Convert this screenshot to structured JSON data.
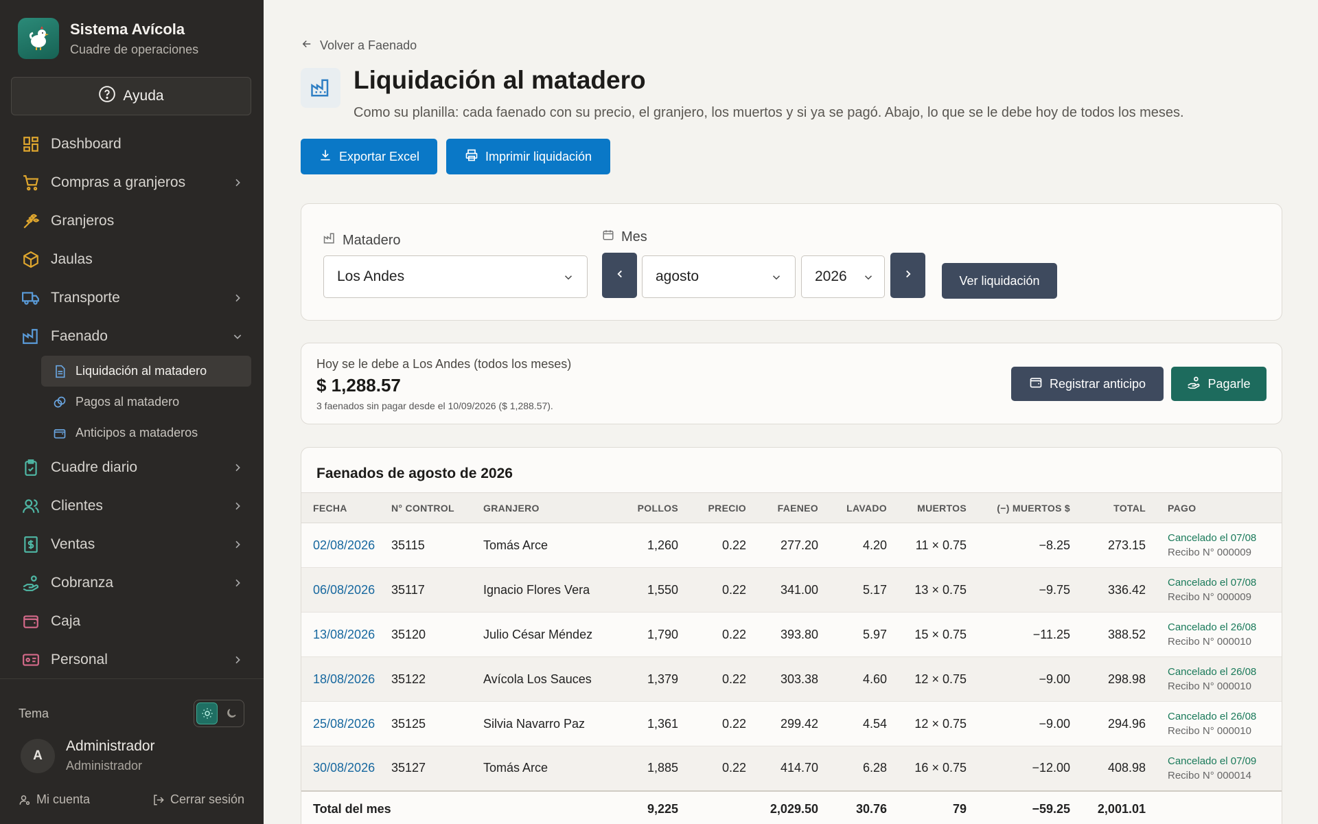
{
  "sidebar": {
    "brand_title": "Sistema Avícola",
    "brand_subtitle": "Cuadre de operaciones",
    "help_label": "Ayuda",
    "items": [
      {
        "label": "Dashboard"
      },
      {
        "label": "Compras a granjeros"
      },
      {
        "label": "Granjeros"
      },
      {
        "label": "Jaulas"
      },
      {
        "label": "Transporte"
      },
      {
        "label": "Faenado"
      },
      {
        "label": "Cuadre diario"
      },
      {
        "label": "Clientes"
      },
      {
        "label": "Ventas"
      },
      {
        "label": "Cobranza"
      },
      {
        "label": "Caja"
      },
      {
        "label": "Personal"
      }
    ],
    "sub_items": [
      {
        "label": "Liquidación al matadero"
      },
      {
        "label": "Pagos al matadero"
      },
      {
        "label": "Anticipos a mataderos"
      }
    ],
    "theme_label": "Tema",
    "user_initial": "A",
    "user_name": "Administrador",
    "user_role": "Administrador",
    "account_label": "Mi cuenta",
    "logout_label": "Cerrar sesión",
    "accent_color": "#1d6b5d"
  },
  "header": {
    "back_label": "Volver a Faenado",
    "title": "Liquidación al matadero",
    "description": "Como su planilla: cada faenado con su precio, el granjero, los muertos y si ya se pagó. Abajo, lo que se le debe hoy de todos los meses.",
    "export_label": "Exportar Excel",
    "print_label": "Imprimir liquidación",
    "primary_color": "#0a78c7"
  },
  "filters": {
    "matadero_label": "Matadero",
    "matadero_value": "Los Andes",
    "mes_label": "Mes",
    "month_value": "agosto",
    "year_value": "2026",
    "ver_label": "Ver liquidación"
  },
  "debt": {
    "label": "Hoy se le debe a Los Andes (todos los meses)",
    "amount": "$ 1,288.57",
    "note": "3 faenados sin pagar desde el 10/09/2026 ($ 1,288.57).",
    "anticipo_label": "Registrar anticipo",
    "pagar_label": "Pagarle"
  },
  "table": {
    "title": "Faenados de agosto de 2026",
    "headers": [
      "FECHA",
      "N° CONTROL",
      "GRANJERO",
      "POLLOS",
      "PRECIO",
      "FAENEO",
      "LAVADO",
      "MUERTOS",
      "(−) MUERTOS $",
      "TOTAL",
      "PAGO"
    ],
    "rows": [
      {
        "fecha": "02/08/2026",
        "control": "35115",
        "granjero": "Tomás Arce",
        "pollos": "1,260",
        "precio": "0.22",
        "faeneo": "277.20",
        "lavado": "4.20",
        "muertos": "11 × 0.75",
        "muertos_monto": "−8.25",
        "total": "273.15",
        "pago": "Cancelado el 07/08",
        "recibo": "Recibo N° 000009"
      },
      {
        "fecha": "06/08/2026",
        "control": "35117",
        "granjero": "Ignacio Flores Vera",
        "pollos": "1,550",
        "precio": "0.22",
        "faeneo": "341.00",
        "lavado": "5.17",
        "muertos": "13 × 0.75",
        "muertos_monto": "−9.75",
        "total": "336.42",
        "pago": "Cancelado el 07/08",
        "recibo": "Recibo N° 000009"
      },
      {
        "fecha": "13/08/2026",
        "control": "35120",
        "granjero": "Julio César Méndez",
        "pollos": "1,790",
        "precio": "0.22",
        "faeneo": "393.80",
        "lavado": "5.97",
        "muertos": "15 × 0.75",
        "muertos_monto": "−11.25",
        "total": "388.52",
        "pago": "Cancelado el 26/08",
        "recibo": "Recibo N° 000010"
      },
      {
        "fecha": "18/08/2026",
        "control": "35122",
        "granjero": "Avícola Los Sauces",
        "pollos": "1,379",
        "precio": "0.22",
        "faeneo": "303.38",
        "lavado": "4.60",
        "muertos": "12 × 0.75",
        "muertos_monto": "−9.00",
        "total": "298.98",
        "pago": "Cancelado el 26/08",
        "recibo": "Recibo N° 000010"
      },
      {
        "fecha": "25/08/2026",
        "control": "35125",
        "granjero": "Silvia Navarro Paz",
        "pollos": "1,361",
        "precio": "0.22",
        "faeneo": "299.42",
        "lavado": "4.54",
        "muertos": "12 × 0.75",
        "muertos_monto": "−9.00",
        "total": "294.96",
        "pago": "Cancelado el 26/08",
        "recibo": "Recibo N° 000010"
      },
      {
        "fecha": "30/08/2026",
        "control": "35127",
        "granjero": "Tomás Arce",
        "pollos": "1,885",
        "precio": "0.22",
        "faeneo": "414.70",
        "lavado": "6.28",
        "muertos": "16 × 0.75",
        "muertos_monto": "−12.00",
        "total": "408.98",
        "pago": "Cancelado el 07/09",
        "recibo": "Recibo N° 000014"
      }
    ],
    "total_row": {
      "label": "Total del mes",
      "pollos": "9,225",
      "faeneo": "2,029.50",
      "lavado": "30.76",
      "muertos": "79",
      "muertos_monto": "−59.25",
      "total": "2,001.01"
    }
  }
}
